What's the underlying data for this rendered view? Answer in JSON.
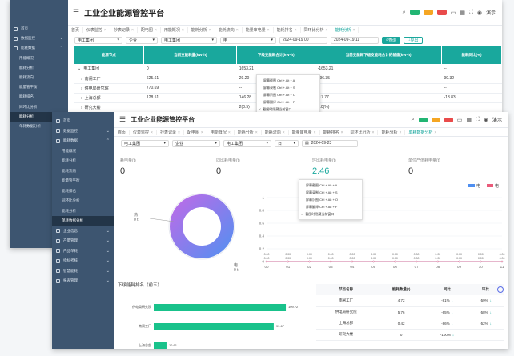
{
  "app": {
    "title": "工业企业能源管控平台",
    "user": "演示"
  },
  "header": {
    "badges": [
      {
        "label": "",
        "count": "",
        "color": "#22b573"
      },
      {
        "label": "",
        "count": "",
        "color": "#f5a623"
      },
      {
        "label": "",
        "count": "",
        "color": "#e94b4b"
      }
    ]
  },
  "back": {
    "sidebar": [
      {
        "label": "首页",
        "type": "top"
      },
      {
        "label": "数据监控",
        "type": "group"
      },
      {
        "label": "能耗数据",
        "type": "group",
        "open": true
      },
      {
        "label": "用能概况",
        "type": "sub"
      },
      {
        "label": "能耗分析",
        "type": "sub"
      },
      {
        "label": "能耗流向",
        "type": "sub"
      },
      {
        "label": "能量管平衡",
        "type": "sub"
      },
      {
        "label": "能耗排名",
        "type": "sub"
      },
      {
        "label": "同环比分析",
        "type": "sub"
      },
      {
        "label": "能耗分析",
        "type": "sub",
        "active": true
      },
      {
        "label": "单耗数据分析",
        "type": "sub"
      }
    ],
    "tabs": [
      "首页",
      "仪表监控",
      "抄表记录",
      "配电图",
      "用能概况",
      "能耗分析",
      "能耗流向",
      "能量审电量",
      "能耗排名",
      "同环比分析",
      "能耗分析"
    ],
    "filters": {
      "node": "电工集团",
      "type": "企业",
      "sub": "电工集团",
      "energy": "电",
      "start": "2024-09-19 00",
      "end": "2024-09-19 11",
      "search": "查询",
      "export": "导出"
    },
    "columns": [
      "能源节点",
      "当前支能耗量(kW*h)",
      "下级支能耗合计(kW*h)",
      "当前支能耗下级支能耗合计的差值(kW*h)",
      "能耗同比(%)"
    ],
    "rows": [
      [
        "电工集团",
        "0",
        "1653.21",
        "-1653.21",
        "--"
      ],
      [
        "南闸工厂",
        "625.61",
        "29.20",
        "596.35",
        "99.32"
      ],
      [
        "供电局研究院",
        "770.69",
        "--",
        "",
        "--"
      ],
      [
        "上海总部",
        "128.51",
        "146.28",
        "-17.77",
        "-13.83"
      ],
      [
        "研究大楼",
        "",
        "2(0.5)",
        "0.0(%)",
        ""
      ]
    ],
    "ctx": [
      "屏幕截图 Ctrl + Alt + A",
      "屏幕录制 Ctrl + Alt + S",
      "屏幕识图 Ctrl + Alt + O",
      "屏幕翻译 Ctrl + Alt + F",
      "截图时隐藏当前窗口"
    ]
  },
  "front": {
    "sidebar": [
      {
        "label": "首页",
        "type": "top"
      },
      {
        "label": "数据监控",
        "type": "group"
      },
      {
        "label": "能耗数据",
        "type": "group",
        "open": true
      },
      {
        "label": "用能概况",
        "type": "sub"
      },
      {
        "label": "能耗分析",
        "type": "sub"
      },
      {
        "label": "能耗流向",
        "type": "sub"
      },
      {
        "label": "能量管平衡",
        "type": "sub"
      },
      {
        "label": "能耗排名",
        "type": "sub"
      },
      {
        "label": "同环比分析",
        "type": "sub"
      },
      {
        "label": "能耗分析",
        "type": "sub"
      },
      {
        "label": "单耗数据分析",
        "type": "sub",
        "active": true
      },
      {
        "label": "企业信息",
        "type": "group"
      },
      {
        "label": "产量管理",
        "type": "group"
      },
      {
        "label": "产品单耗",
        "type": "group"
      },
      {
        "label": "指标考核",
        "type": "group"
      },
      {
        "label": "智慧能耗",
        "type": "group"
      },
      {
        "label": "报表管理",
        "type": "group"
      }
    ],
    "tabs": [
      "首页",
      "仪表监控",
      "抄表记录",
      "配电图",
      "用能概况",
      "能耗分析",
      "能耗流向",
      "能量审电量",
      "能耗排名",
      "同环比分析",
      "能耗分析",
      "单耗数据分析"
    ],
    "filters": {
      "node": "电工集团",
      "type": "企业",
      "sub": "电工集团",
      "period": "日",
      "date": "2024-09-23"
    },
    "stats": [
      {
        "label": "耗电量(t)",
        "value": "0"
      },
      {
        "label": "同比耗电量(t)",
        "value": "0"
      },
      {
        "label": "环比耗电量(t)",
        "value": "2.46"
      },
      {
        "label": "单位产值耗电量(t)",
        "value": "0"
      }
    ],
    "pie_labels": [
      "热",
      "0 t",
      "电",
      "0 t"
    ],
    "legend": [
      {
        "name": "电",
        "color": "#4f8ff0"
      },
      {
        "name": "电",
        "color": "#ea5b7a"
      }
    ],
    "ctx": [
      "屏幕截图 Ctrl + Alt + A",
      "屏幕录制 Ctrl + Alt + S",
      "屏幕识图 Ctrl + Alt + O",
      "屏幕翻译 Ctrl + Alt + F",
      "截图时隐藏当前窗口"
    ],
    "ranking_title": "下级能耗排名（前五）",
    "table_columns": [
      "节点名称",
      "能耗数量(t)",
      "同比",
      "环比"
    ],
    "table_rows": [
      [
        "南闸工厂",
        "4.72",
        "-81%",
        "-59%"
      ],
      [
        "供电局研究院",
        "5.76",
        "-65%",
        "-58%"
      ],
      [
        "上海总部",
        "0.42",
        "-86%",
        "-52%"
      ],
      [
        "研究大楼",
        "0",
        "-100%",
        ""
      ]
    ]
  },
  "chart_data": [
    {
      "type": "bar",
      "orientation": "horizontal",
      "title": "下级能耗排名（前五）",
      "categories": [
        "供电局研究院",
        "南闸工厂",
        "上海总部"
      ],
      "values": [
        109.72,
        99.67,
        10.61
      ],
      "xlim": [
        0,
        120
      ],
      "color": "#19c28b"
    },
    {
      "type": "line",
      "x": [
        "00",
        "01",
        "02",
        "03",
        "04",
        "05",
        "06",
        "07",
        "08",
        "09",
        "10",
        "11"
      ],
      "series": [
        {
          "name": "电",
          "values": [
            0,
            0,
            0,
            0,
            0,
            0,
            0,
            0,
            0,
            0,
            0,
            0
          ]
        },
        {
          "name": "电",
          "values": [
            0,
            0,
            0,
            0,
            0,
            0,
            0,
            0,
            0,
            0,
            0,
            0
          ]
        }
      ],
      "yticks": [
        "0",
        "0.2",
        "0.4",
        "0.6",
        "0.8",
        "1"
      ],
      "ylim": [
        0,
        1
      ]
    },
    {
      "type": "pie",
      "labels": [
        "热",
        "电"
      ],
      "values": [
        0,
        0
      ]
    }
  ]
}
